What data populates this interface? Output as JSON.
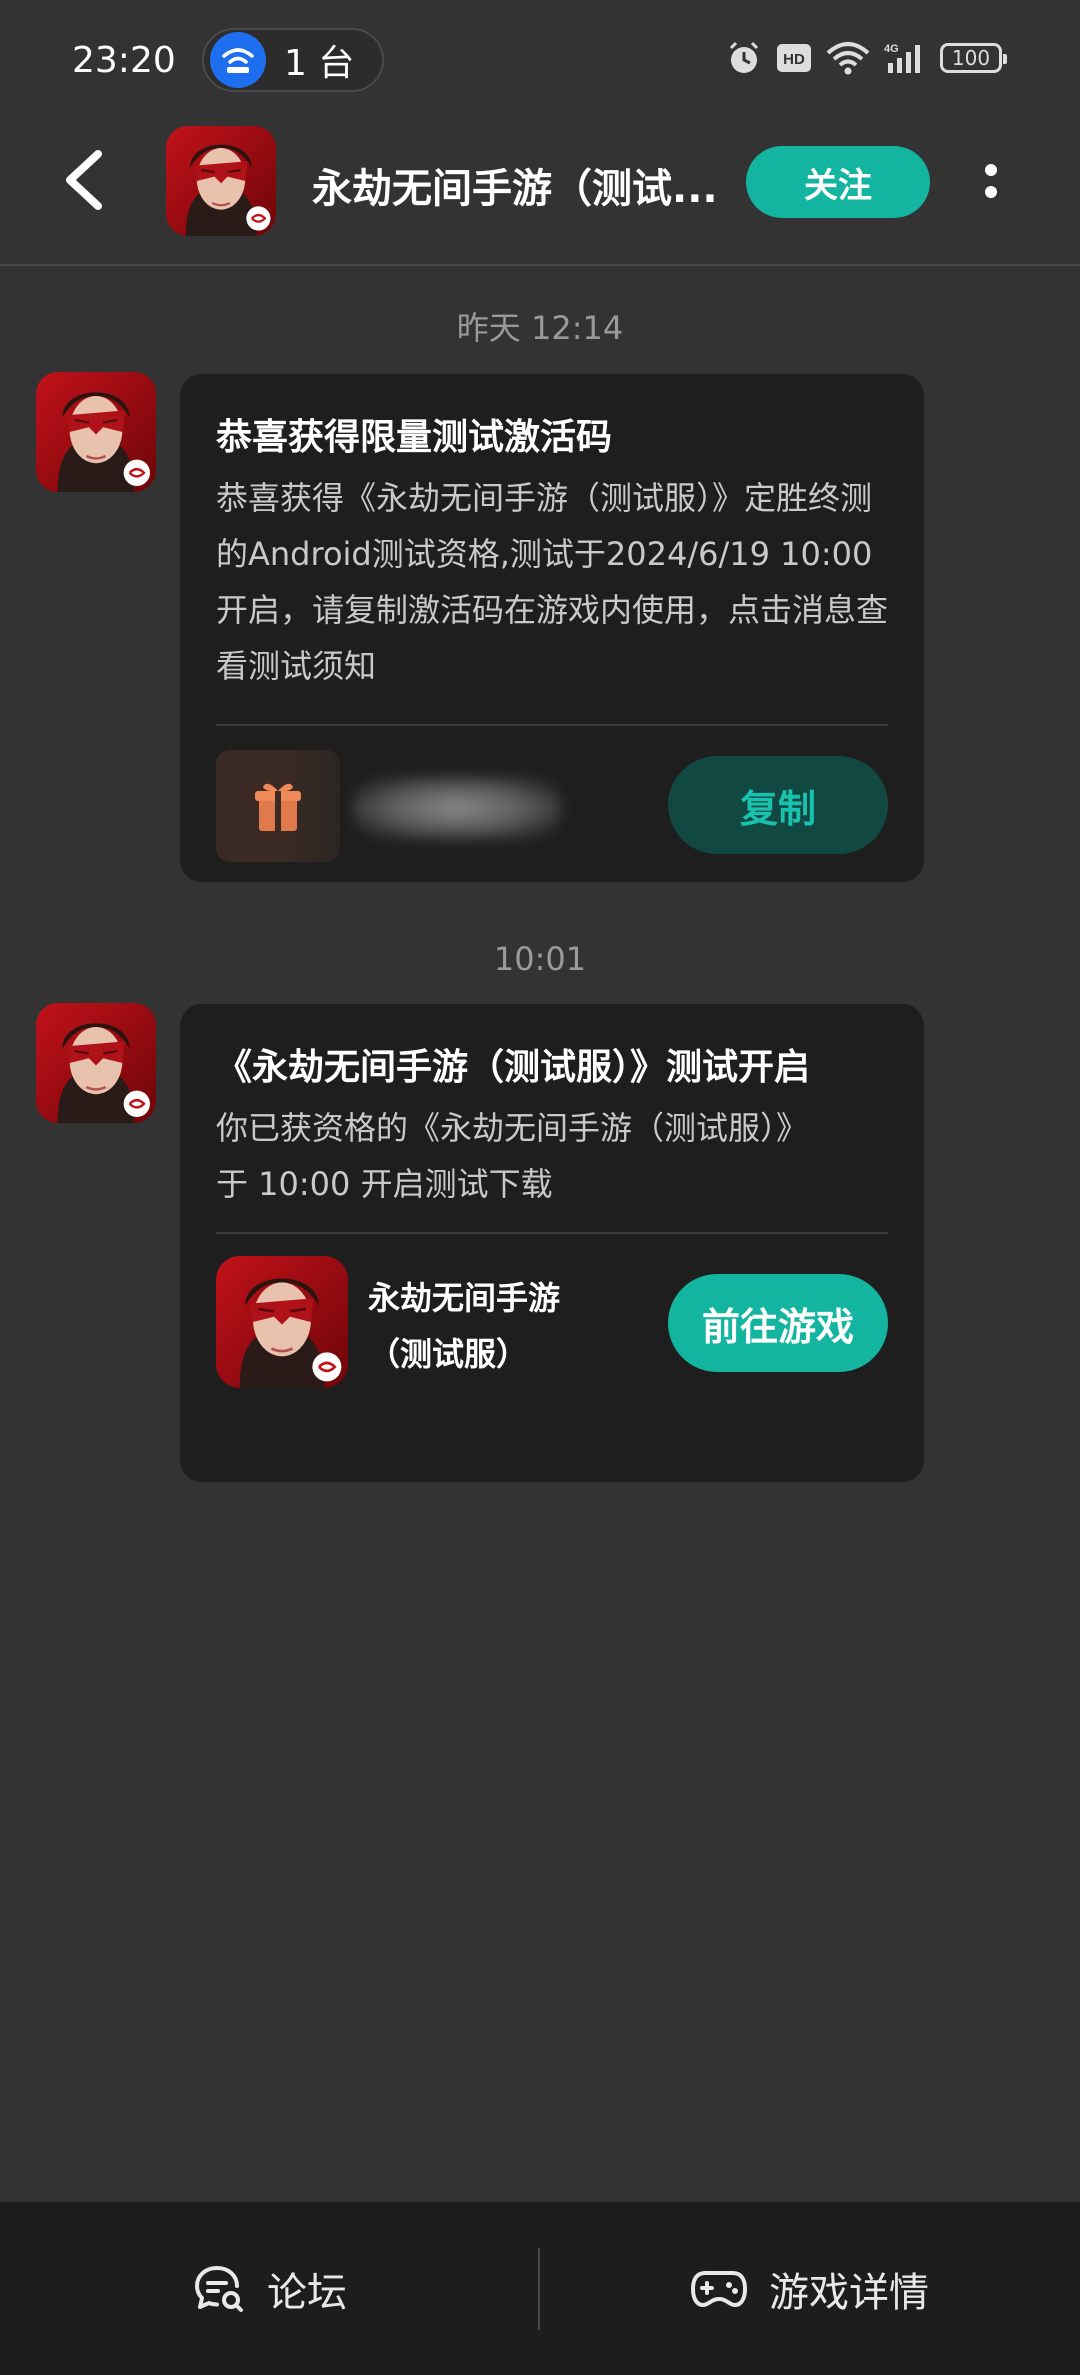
{
  "status_bar": {
    "time": "23:20",
    "hotspot_count": "1 台",
    "battery": "100",
    "network": "4G"
  },
  "header": {
    "title": "永劫无间手游（测试...",
    "follow_label": "关注"
  },
  "messages": [
    {
      "timestamp": "昨天  12:14",
      "title": "恭喜获得限量测试激活码",
      "body": "恭喜获得《永劫无间手游（测试服）》定胜终测的Android测试资格,测试于2024/6/19 10:00 开启，请复制激活码在游戏内使用，点击消息查看测试须知",
      "action_label": "复制"
    },
    {
      "timestamp": "10:01",
      "title": "《永劫无间手游（测试服）》测试开启",
      "body": "你已获资格的《永劫无间手游（测试服）》于 10:00 开启测试下载",
      "game_name": "永劫无间手游（测试服）",
      "action_label": "前往游戏"
    }
  ],
  "bottom_bar": {
    "forum_label": "论坛",
    "details_label": "游戏详情"
  },
  "colors": {
    "accent": "#13b5a0",
    "background": "#333333",
    "card": "#1e1e1e"
  }
}
